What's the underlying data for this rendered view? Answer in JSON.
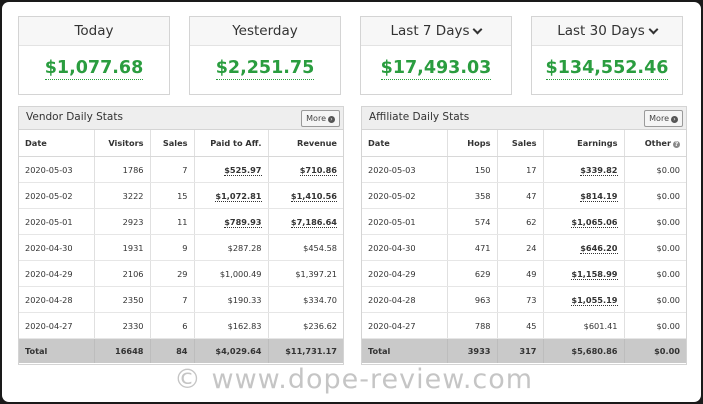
{
  "cards": [
    {
      "label": "Today",
      "value": "$1,077.68",
      "dropdown": false
    },
    {
      "label": "Yesterday",
      "value": "$2,251.75",
      "dropdown": false
    },
    {
      "label": "Last 7 Days",
      "value": "$17,493.03",
      "dropdown": true
    },
    {
      "label": "Last 30 Days",
      "value": "$134,552.46",
      "dropdown": true
    }
  ],
  "vendor": {
    "title": "Vendor Daily Stats",
    "more_label": "More",
    "columns": [
      "Date",
      "Visitors",
      "Sales",
      "Paid to Aff.",
      "Revenue"
    ],
    "rows": [
      {
        "date": "2020-05-03",
        "visitors": "1786",
        "sales": "7",
        "paid": "$525.97",
        "revenue": "$710.86"
      },
      {
        "date": "2020-05-02",
        "visitors": "3222",
        "sales": "15",
        "paid": "$1,072.81",
        "revenue": "$1,410.56"
      },
      {
        "date": "2020-05-01",
        "visitors": "2923",
        "sales": "11",
        "paid": "$789.93",
        "revenue": "$7,186.64"
      },
      {
        "date": "2020-04-30",
        "visitors": "1931",
        "sales": "9",
        "paid": "$287.28",
        "revenue": "$454.58"
      },
      {
        "date": "2020-04-29",
        "visitors": "2106",
        "sales": "29",
        "paid": "$1,000.49",
        "revenue": "$1,397.21"
      },
      {
        "date": "2020-04-28",
        "visitors": "2350",
        "sales": "7",
        "paid": "$190.33",
        "revenue": "$334.70"
      },
      {
        "date": "2020-04-27",
        "visitors": "2330",
        "sales": "6",
        "paid": "$162.83",
        "revenue": "$236.62"
      }
    ],
    "total": {
      "label": "Total",
      "visitors": "16648",
      "sales": "84",
      "paid": "$4,029.64",
      "revenue": "$11,731.17"
    }
  },
  "affiliate": {
    "title": "Affiliate Daily Stats",
    "more_label": "More",
    "columns": [
      "Date",
      "Hops",
      "Sales",
      "Earnings",
      "Other"
    ],
    "rows": [
      {
        "date": "2020-05-03",
        "hops": "150",
        "sales": "17",
        "earnings": "$339.82",
        "other": "$0.00"
      },
      {
        "date": "2020-05-02",
        "hops": "358",
        "sales": "47",
        "earnings": "$814.19",
        "other": "$0.00"
      },
      {
        "date": "2020-05-01",
        "hops": "574",
        "sales": "62",
        "earnings": "$1,065.06",
        "other": "$0.00"
      },
      {
        "date": "2020-04-30",
        "hops": "471",
        "sales": "24",
        "earnings": "$646.20",
        "other": "$0.00"
      },
      {
        "date": "2020-04-29",
        "hops": "629",
        "sales": "49",
        "earnings": "$1,158.99",
        "other": "$0.00"
      },
      {
        "date": "2020-04-28",
        "hops": "963",
        "sales": "73",
        "earnings": "$1,055.19",
        "other": "$0.00"
      },
      {
        "date": "2020-04-27",
        "hops": "788",
        "sales": "45",
        "earnings": "$601.41",
        "other": "$0.00"
      }
    ],
    "total": {
      "label": "Total",
      "hops": "3933",
      "sales": "317",
      "earnings": "$5,680.86",
      "other": "$0.00"
    }
  },
  "watermark": "© www.dope-review.com",
  "colors": {
    "value_green": "#2a9d3f",
    "total_row": "#c9c9c9",
    "panel_header": "#eeeeee"
  }
}
